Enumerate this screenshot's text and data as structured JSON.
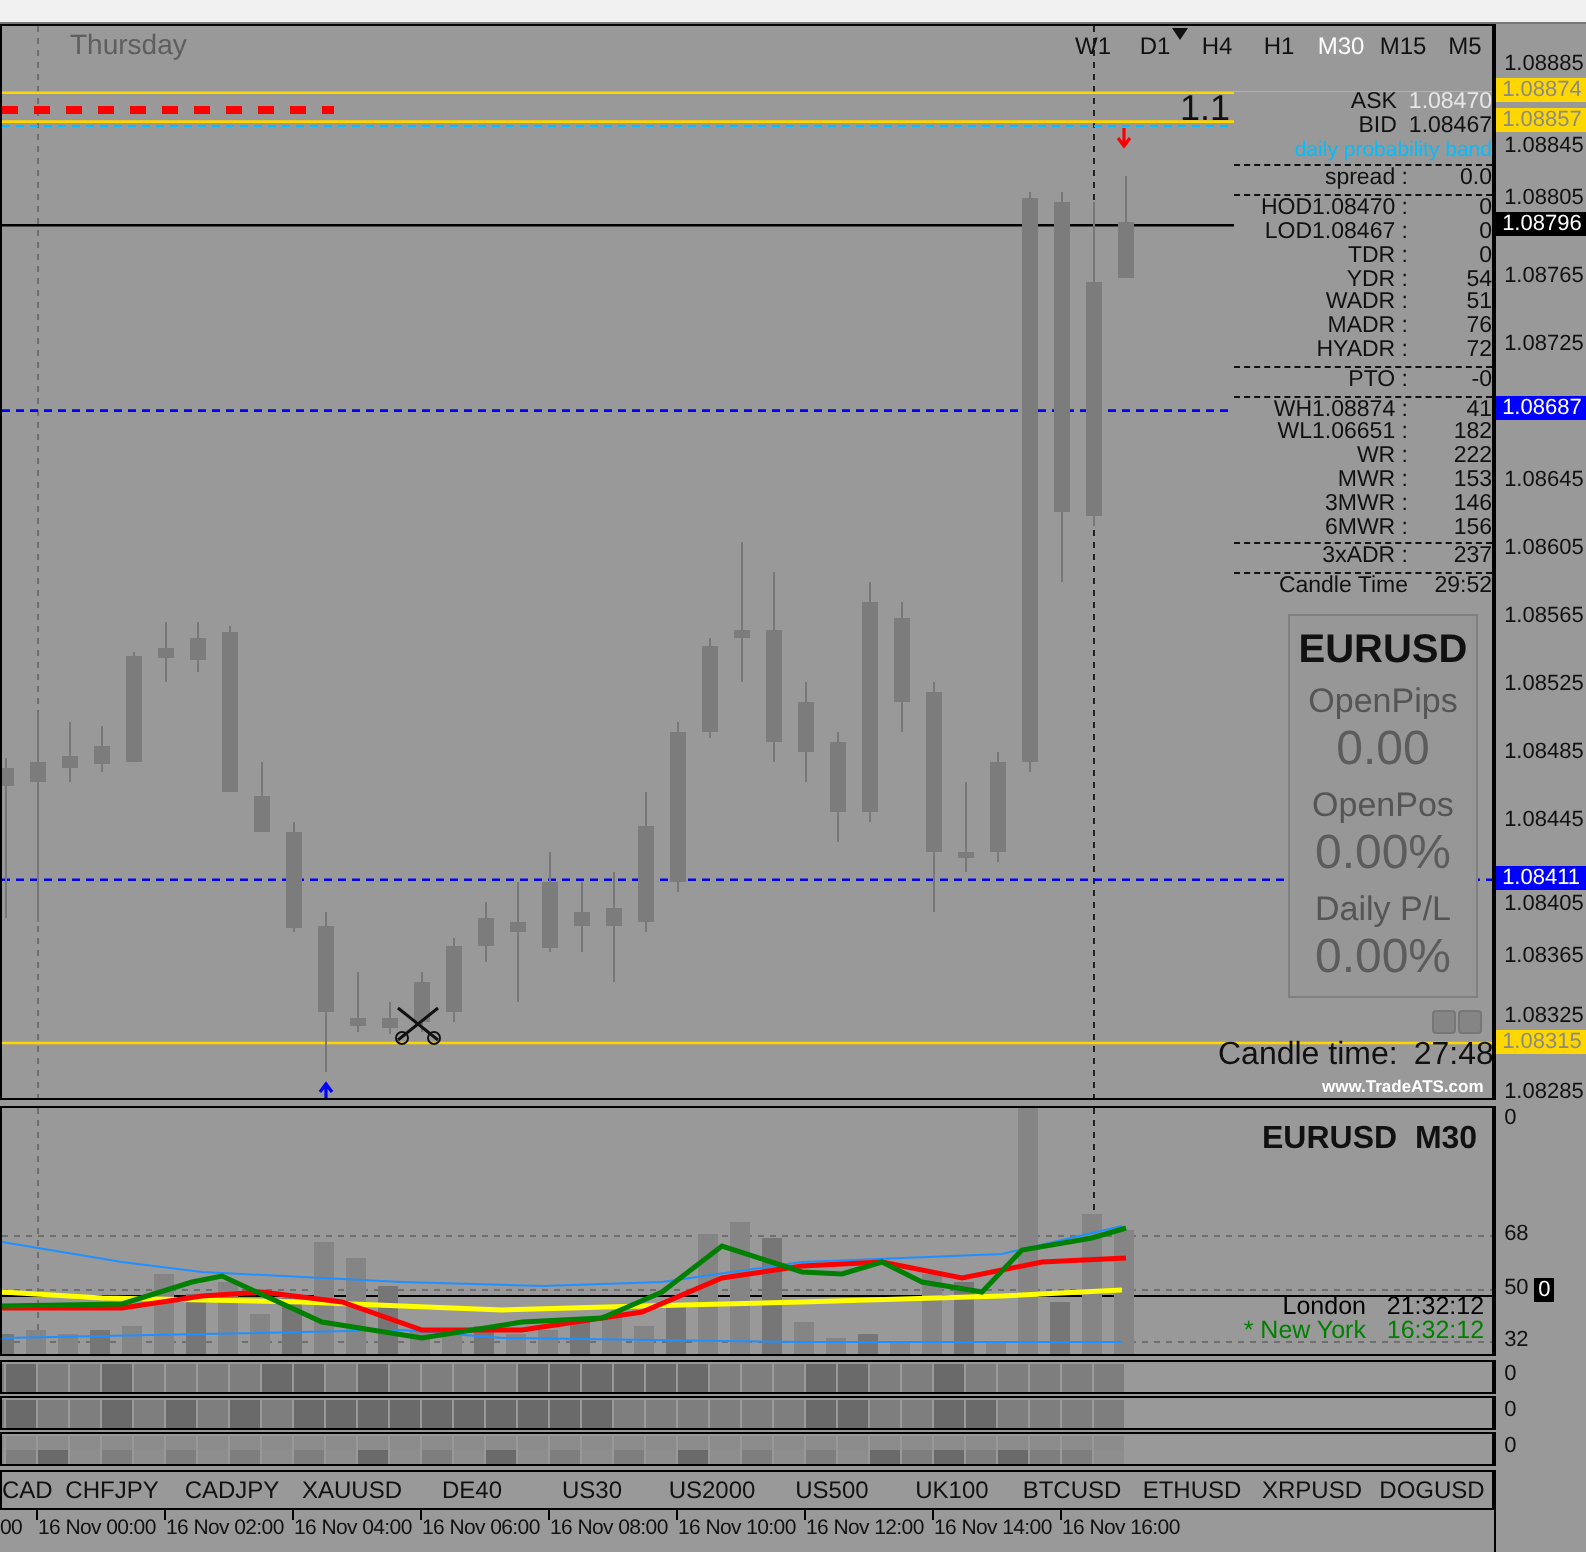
{
  "timeframes": [
    {
      "label": "W1",
      "selected": false
    },
    {
      "label": "D1",
      "selected": false
    },
    {
      "label": "H4",
      "selected": false
    },
    {
      "label": "H1",
      "selected": false
    },
    {
      "label": "M30",
      "selected": true
    },
    {
      "label": "M15",
      "selected": false
    },
    {
      "label": "M5",
      "selected": false
    }
  ],
  "day_label": "Thursday",
  "ratio_label": "1.1",
  "band_label": "daily probability band",
  "stats_groups": [
    [
      {
        "label": "ASK",
        "value": "1.08470"
      },
      {
        "label": "BID",
        "value": "1.08467"
      }
    ],
    [
      {
        "label": "spread :",
        "value": "0.0"
      }
    ],
    [
      {
        "label": "HOD1.08470 :",
        "value": "0"
      },
      {
        "label": "LOD1.08467 :",
        "value": "0"
      },
      {
        "label": "TDR :",
        "value": "0"
      },
      {
        "label": "YDR :",
        "value": "54"
      },
      {
        "label": "WADR :",
        "value": "51"
      },
      {
        "label": "MADR :",
        "value": "76"
      },
      {
        "label": "HYADR :",
        "value": "72"
      }
    ],
    [
      {
        "label": "PTO :",
        "value": "-0"
      }
    ],
    [
      {
        "label": "WH1.08874 :",
        "value": "41"
      },
      {
        "label": "WL1.06651 :",
        "value": "182"
      },
      {
        "label": "WR :",
        "value": "222"
      },
      {
        "label": "MWR :",
        "value": "153"
      },
      {
        "label": "3MWR :",
        "value": "146"
      },
      {
        "label": "6MWR :",
        "value": "156"
      }
    ],
    [
      {
        "label": "3xADR :",
        "value": "237"
      }
    ],
    [
      {
        "label": "Candle Time",
        "value": "29:52"
      }
    ]
  ],
  "price_axis": [
    "1.08885",
    "1.08845",
    "1.08805",
    "1.08765",
    "1.08725",
    "1.08645",
    "1.08605",
    "1.08565",
    "1.08525",
    "1.08485",
    "1.08445",
    "1.08405",
    "1.08365",
    "1.08325",
    "1.08285"
  ],
  "price_tags": [
    {
      "value": "1.08874",
      "color": "#ffd700",
      "kind": "solid"
    },
    {
      "value": "1.08857",
      "color": "#ffd700",
      "kind": "solid"
    },
    {
      "value": "1.08796",
      "color": "#000000",
      "kind": "solid"
    },
    {
      "value": "1.08687",
      "color": "#0000ff",
      "kind": "dashed"
    },
    {
      "value": "1.08411",
      "color": "#0000ff",
      "kind": "dashed"
    },
    {
      "value": "1.08315",
      "color": "#ffd700",
      "kind": "solid"
    }
  ],
  "account_panel": {
    "symbol": "EURUSD",
    "items": [
      {
        "label": "OpenPips",
        "value": "0.00"
      },
      {
        "label": "OpenPos",
        "value": "0.00%"
      },
      {
        "label": "Daily P/L",
        "value": "0.00%"
      }
    ]
  },
  "candle_timer": {
    "label": "Candle time:",
    "value": "27:48"
  },
  "site_link": "www.TradeATS.com",
  "indicator": {
    "title": "EURUSD  M30",
    "axis": [
      "0",
      "68",
      "50",
      "32"
    ],
    "level_tag": "0",
    "clocks": [
      {
        "city": "London",
        "time": "21:32:12",
        "color": "#000000"
      },
      {
        "city": "* New York",
        "time": "16:32:12",
        "color": "#008000"
      }
    ]
  },
  "strip_axis": [
    "0",
    "0",
    "0"
  ],
  "symbols": [
    "CAD",
    "CHFJPY",
    "CADJPY",
    "XAUUSD",
    "DE40",
    "US30",
    "US2000",
    "US500",
    "UK100",
    "BTCUSD",
    "ETHUSD",
    "XRPUSD",
    "DOGUSD"
  ],
  "time_axis": [
    "00",
    "16 Nov 00:00",
    "16 Nov 02:00",
    "16 Nov 04:00",
    "16 Nov 06:00",
    "16 Nov 08:00",
    "16 Nov 10:00",
    "16 Nov 12:00",
    "16 Nov 14:00",
    "16 Nov 16:00"
  ]
}
